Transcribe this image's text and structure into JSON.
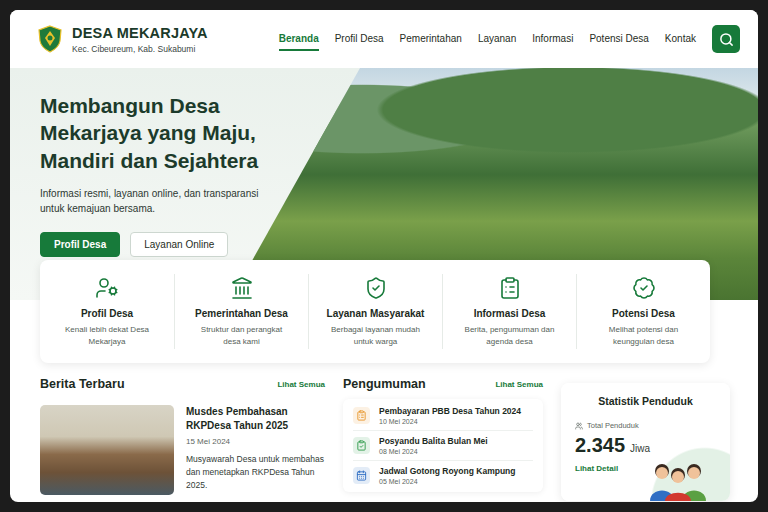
{
  "header": {
    "title": "DESA MEKARJAYA",
    "subtitle": "Kec. Cibeureum, Kab. Sukabumi"
  },
  "nav": [
    {
      "label": "Beranda",
      "selected": true
    },
    {
      "label": "Profil Desa",
      "selected": false
    },
    {
      "label": "Pemerintahan",
      "selected": false
    },
    {
      "label": "Layanan",
      "selected": false
    },
    {
      "label": "Informasi",
      "selected": false
    },
    {
      "label": "Potensi Desa",
      "selected": false
    },
    {
      "label": "Kontak",
      "selected": false
    }
  ],
  "hero": {
    "headline": [
      "Membangun Desa",
      "Mekarjaya yang Maju,",
      "Mandiri dan Sejahtera"
    ],
    "subtitle": [
      "Informasi resmi, layanan online, dan transparansi",
      "untuk kemajuan bersama."
    ],
    "buttons": [
      {
        "label": "Profil Desa",
        "kind": "primary"
      },
      {
        "label": "Layanan Online",
        "kind": "secondary"
      }
    ]
  },
  "features": [
    {
      "title": "Profil Desa",
      "description": "Kenali lebih dekat Desa Mekarjaya"
    },
    {
      "title": "Pemerintahan Desa",
      "description": "Struktur dan perangkat desa kami"
    },
    {
      "title": "Layanan Masyarakat",
      "description": "Berbagai layanan mudah untuk warga"
    },
    {
      "title": "Informasi Desa",
      "description": "Berita, pengumuman dan agenda desa"
    },
    {
      "title": "Potensi Desa",
      "description": "Melihat potensi dan keunggulan desa"
    }
  ],
  "news": {
    "title": "Berita Terbaru",
    "more": "Lihat Semua",
    "items": [
      {
        "title": "Musdes Pembahasan RKPDesa Tahun 2025",
        "date": "15 Mei 2024",
        "summary": "Musyawarah Desa untuk membahas dan menetapkan RKPDesa Tahun 2025."
      }
    ]
  },
  "announcements": {
    "title": "Pengumuman",
    "more": "Lihat Semua",
    "items": [
      {
        "title": "Pembayaran PBB Desa Tahun 2024",
        "date": "10 Mei 2024",
        "color": "#e8962a"
      },
      {
        "title": "Posyandu Balita Bulan Mei",
        "date": "08 Mei 2024",
        "color": "#2f9a4a"
      },
      {
        "title": "Jadwal Gotong Royong Kampung",
        "date": "05 Mei 2024",
        "color": "#2f6fc4"
      }
    ]
  },
  "stats": {
    "title": "Statistik Penduduk",
    "label": "Total Penduduk",
    "value": "2.345",
    "unit": "Jiwa",
    "link": "Lihat Detail"
  }
}
